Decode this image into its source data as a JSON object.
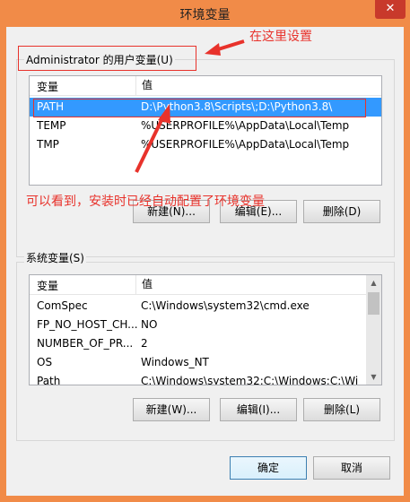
{
  "window": {
    "title": "环境变量",
    "close_glyph": "✕"
  },
  "user_group": {
    "label": "Administrator 的用户变量(U)",
    "columns": [
      "变量",
      "值"
    ],
    "rows": [
      {
        "name": "PATH",
        "value": "D:\\Python3.8\\Scripts\\;D:\\Python3.8\\"
      },
      {
        "name": "TEMP",
        "value": "%USERPROFILE%\\AppData\\Local\\Temp"
      },
      {
        "name": "TMP",
        "value": "%USERPROFILE%\\AppData\\Local\\Temp"
      }
    ],
    "buttons": {
      "new": "新建(N)...",
      "edit": "编辑(E)...",
      "delete": "删除(D)"
    }
  },
  "system_group": {
    "label": "系统变量(S)",
    "columns": [
      "变量",
      "值"
    ],
    "rows": [
      {
        "name": "ComSpec",
        "value": "C:\\Windows\\system32\\cmd.exe"
      },
      {
        "name": "FP_NO_HOST_CH...",
        "value": "NO"
      },
      {
        "name": "NUMBER_OF_PR...",
        "value": "2"
      },
      {
        "name": "OS",
        "value": "Windows_NT"
      },
      {
        "name": "Path",
        "value": "C:\\Windows\\system32;C:\\Windows;C:\\Wi"
      }
    ],
    "buttons": {
      "new": "新建(W)...",
      "edit": "编辑(I)...",
      "delete": "删除(L)"
    }
  },
  "footer": {
    "ok": "确定",
    "cancel": "取消"
  },
  "annotations": {
    "set_here": "在这里设置",
    "auto_config": "可以看到，安装时已经自动配置了环境变量"
  },
  "colors": {
    "accent_frame": "#f18b48",
    "selection": "#3399ff",
    "annotation": "#e8322b"
  }
}
